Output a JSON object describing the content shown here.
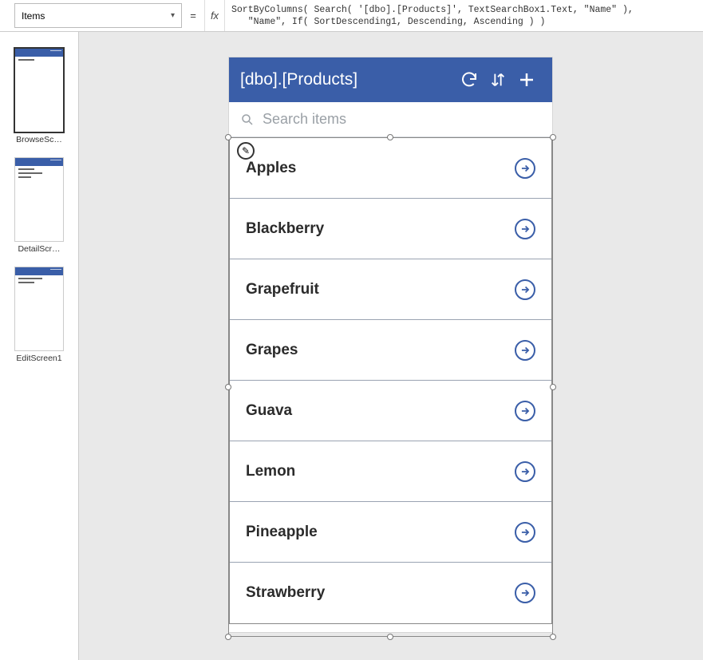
{
  "formulaBar": {
    "property": "Items",
    "equals": "=",
    "fx": "fx",
    "formula": "SortByColumns( Search( '[dbo].[Products]', TextSearchBox1.Text, \"Name\" ),\n   \"Name\", If( SortDescending1, Descending, Ascending ) )"
  },
  "thumbnails": [
    {
      "label": "BrowseSc…",
      "selected": true
    },
    {
      "label": "DetailScr…",
      "selected": false
    },
    {
      "label": "EditScreen1",
      "selected": false
    }
  ],
  "app": {
    "title": "[dbo].[Products]",
    "searchPlaceholder": "Search items",
    "items": [
      {
        "name": "Apples"
      },
      {
        "name": "Blackberry"
      },
      {
        "name": "Grapefruit"
      },
      {
        "name": "Grapes"
      },
      {
        "name": "Guava"
      },
      {
        "name": "Lemon"
      },
      {
        "name": "Pineapple"
      },
      {
        "name": "Strawberry"
      }
    ]
  },
  "icons": {
    "pencil": "✎"
  }
}
